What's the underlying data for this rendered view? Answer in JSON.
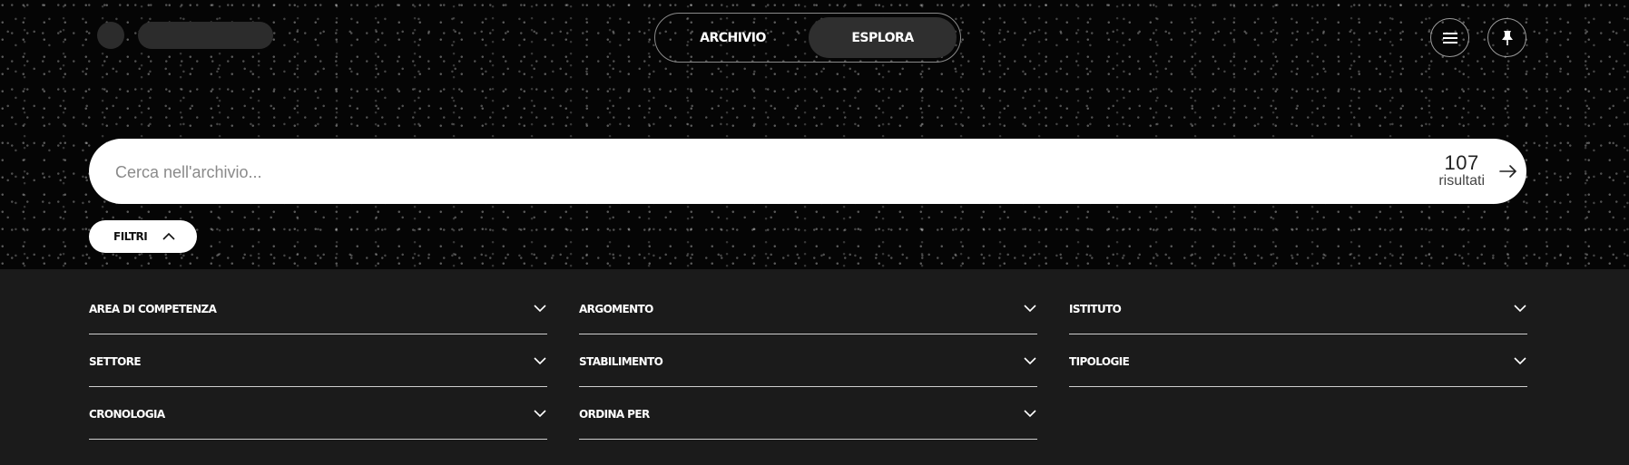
{
  "header": {
    "tabs": [
      {
        "label": "ARCHIVIO",
        "active": false
      },
      {
        "label": "ESPLORA",
        "active": true
      }
    ],
    "icons": {
      "menu": "hamburger-menu-icon",
      "pin": "pin-icon"
    }
  },
  "search": {
    "placeholder": "Cerca nell'archivio...",
    "value": "",
    "result_count": "107",
    "result_label": "risultati"
  },
  "filters_toggle": {
    "label": "FILTRI",
    "expanded": true
  },
  "filters": [
    {
      "label": "AREA DI COMPETENZA"
    },
    {
      "label": "ARGOMENTO"
    },
    {
      "label": "ISTITUTO"
    },
    {
      "label": "SETTORE"
    },
    {
      "label": "STABILIMENTO"
    },
    {
      "label": "TIPOLOGIE"
    },
    {
      "label": "CRONOLOGIA"
    },
    {
      "label": "ORDINA PER"
    }
  ],
  "colors": {
    "hero_background": "#050505",
    "panel_background": "#1b1b1b",
    "active_tab": "#2f2f2f",
    "search_background": "#ffffff"
  }
}
